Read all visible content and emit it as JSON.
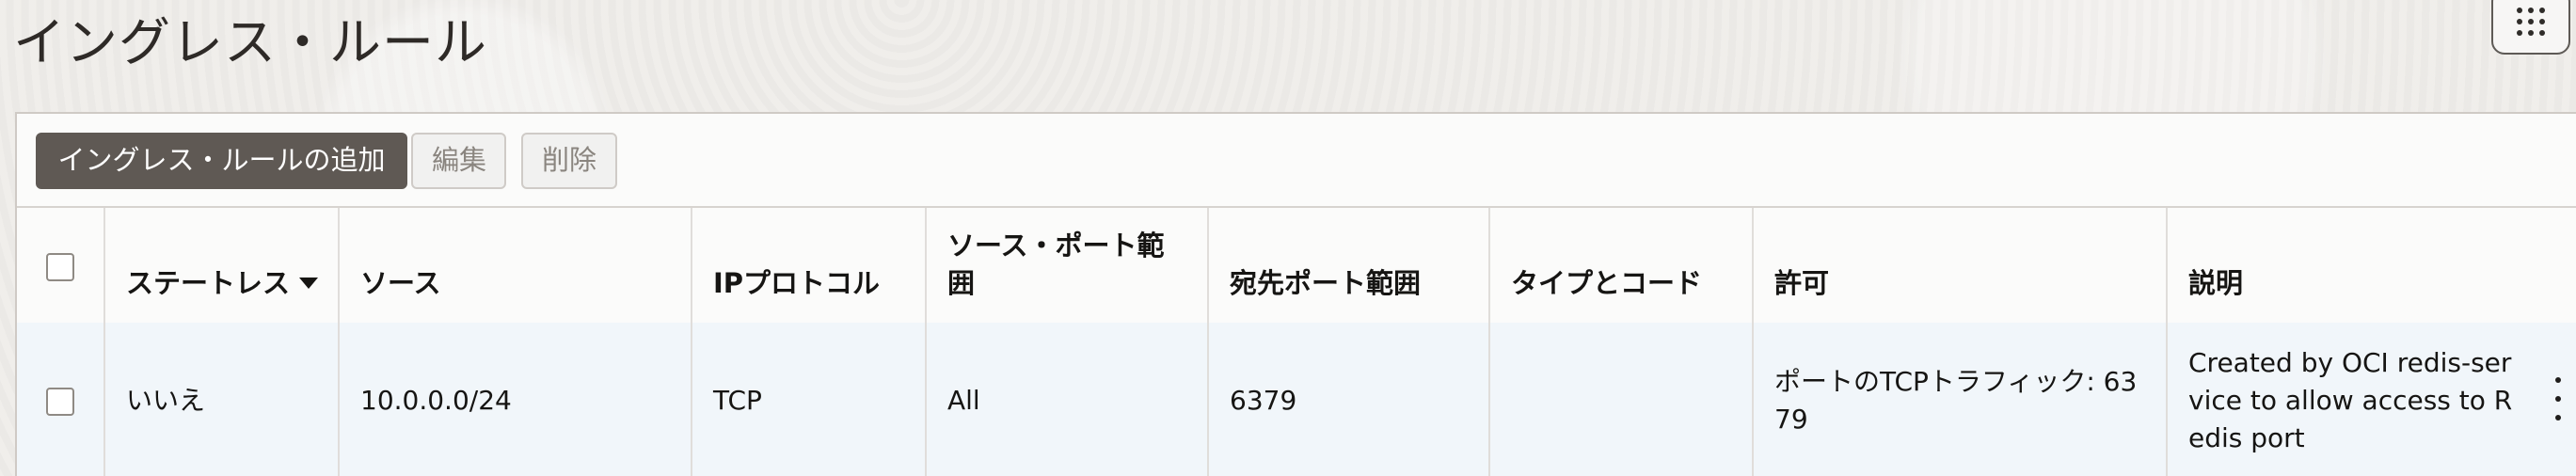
{
  "page": {
    "title": "イングレス・ルール"
  },
  "toolbar": {
    "add_rule_label": "イングレス・ルールの追加",
    "edit_label": "編集",
    "delete_label": "削除"
  },
  "table": {
    "headers": {
      "stateless": "ステートレス",
      "source": "ソース",
      "ip_protocol": "IPプロトコル",
      "source_port_range": "ソース・ポート範囲",
      "destination_port_range": "宛先ポート範囲",
      "type_and_code": "タイプとコード",
      "allows": "許可",
      "description": "説明"
    },
    "rows": [
      {
        "stateless": "いいえ",
        "source": "10.0.0.0/24",
        "ip_protocol": "TCP",
        "source_port_range": "All",
        "destination_port_range": "6379",
        "type_and_code": "",
        "allows": "ポートのTCPトラフィック: 6379",
        "description": "Created by OCI redis-service to allow access to Redis port"
      }
    ]
  },
  "icons": {
    "app_launcher": "grid-icon",
    "sort": "sort-down-icon",
    "row_actions": "kebab-menu-icon"
  },
  "colors": {
    "primary_button": "#5f5954",
    "row_highlight": "#f1f6fa",
    "border": "#d7d3cf"
  }
}
